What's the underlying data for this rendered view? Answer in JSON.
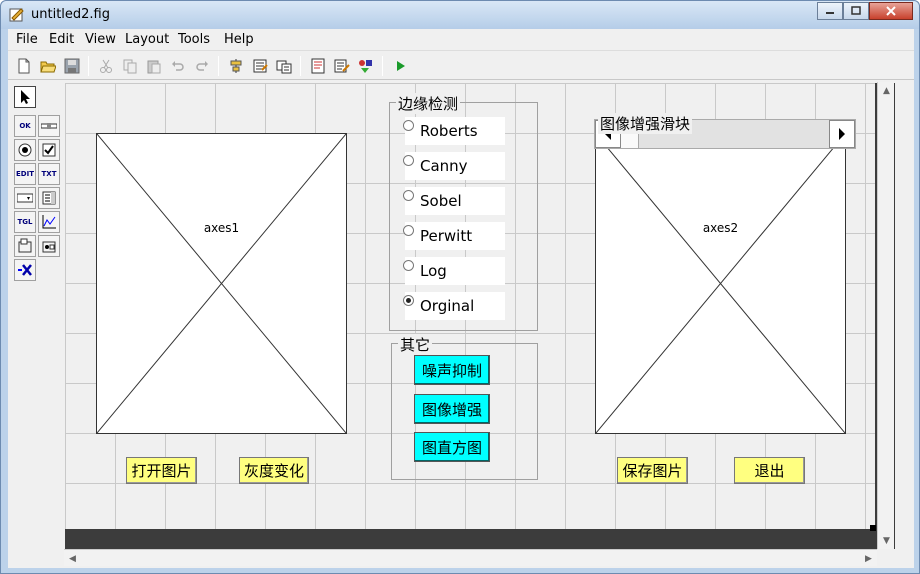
{
  "window": {
    "title": "untitled2.fig"
  },
  "menu": [
    "File",
    "Edit",
    "View",
    "Layout",
    "Tools",
    "Help"
  ],
  "toolbar": {
    "icons": [
      "new-file-icon",
      "open-folder-icon",
      "save-icon",
      "cut-icon",
      "copy-icon",
      "paste-icon",
      "undo-icon",
      "redo-icon",
      "align-icon",
      "menu-editor-icon",
      "tab-order-icon",
      "m-file-editor-icon",
      "property-inspector-icon",
      "object-browser-icon",
      "run-icon"
    ]
  },
  "palette": {
    "items": [
      "select-tool",
      "push-button-tool",
      "slider-tool",
      "radio-button-tool",
      "checkbox-tool",
      "edit-text-tool",
      "static-text-tool",
      "popup-menu-tool",
      "listbox-tool",
      "toggle-button-tool",
      "axes-tool",
      "panel-tool",
      "button-group-tool",
      "activex-tool"
    ],
    "labels": {
      "ok": "OK",
      "edit": "EDIT",
      "txt": "TXT",
      "tgl": "TGL"
    }
  },
  "axes1": {
    "label": "axes1"
  },
  "axes2": {
    "label": "axes2"
  },
  "edge_group": {
    "title": "边缘检测",
    "options": [
      "Roberts",
      "Canny",
      "Sobel",
      "Perwitt",
      "Log",
      "Orginal"
    ],
    "selected_index": 5
  },
  "other_group": {
    "title": "其它",
    "buttons": [
      "噪声抑制",
      "图像增强",
      "图直方图"
    ]
  },
  "slider": {
    "title": "图像增强滑块",
    "value": 0
  },
  "buttons": {
    "open_image": "打开图片",
    "gray_change": "灰度变化",
    "save_image": "保存图片",
    "exit": "退出"
  },
  "colors": {
    "cyan_button": "#00ffff",
    "yellow_button": "#ffff80",
    "dark_border": "#3c3c3c"
  }
}
